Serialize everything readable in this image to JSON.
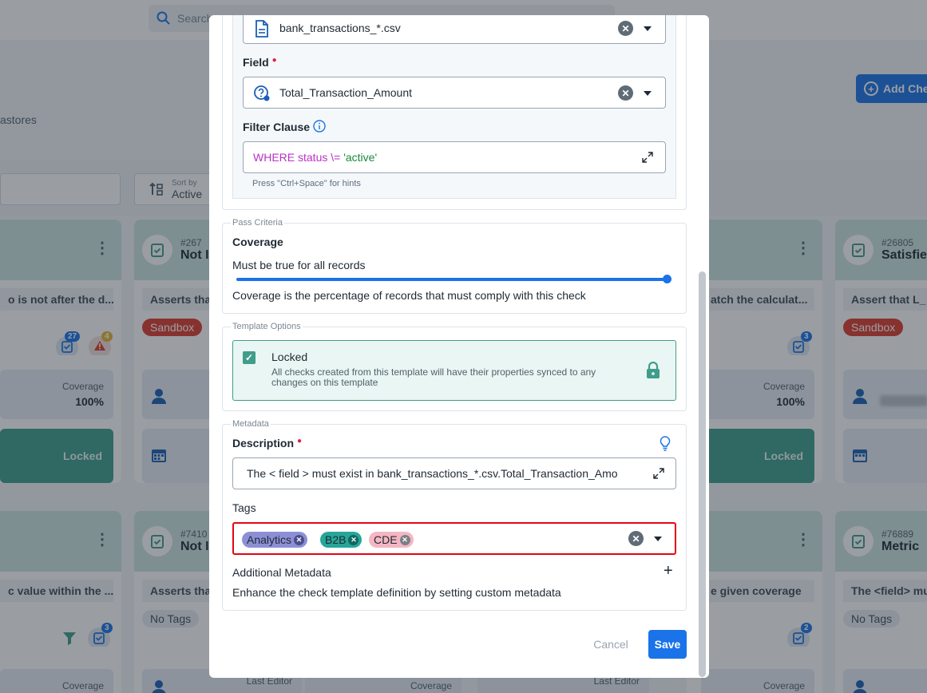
{
  "background": {
    "search_placeholder": "Search",
    "add_button_label": "Add Che",
    "tab_text": "astores",
    "sort": {
      "caption": "Sort by",
      "value": "Active"
    },
    "cards": [
      {
        "title": "",
        "description": "o is not after the d...",
        "coverage_label": "Coverage",
        "coverage_value": "100%",
        "locked_label": "Locked",
        "badge_checks": "27",
        "badge_alerts": "4"
      },
      {
        "number": "#267",
        "title": "Not I",
        "description": "Asserts tha",
        "status_tag": "Sandbox"
      },
      {
        "title": "",
        "description": "atch the calculat...",
        "coverage_label": "Coverage",
        "coverage_value": "100%",
        "locked_label": "Locked",
        "badge_checks": "3"
      },
      {
        "number": "#26805",
        "title": "Satisfie",
        "description": "Assert that L_",
        "status_tag": "Sandbox"
      },
      {
        "title": "",
        "description": "c value within the ...",
        "badge_checks": "3",
        "coverage_label": "Coverage"
      },
      {
        "number": "#7410",
        "title": "Not I",
        "description": "Asserts tha",
        "status_tag": "No Tags",
        "last_editor_label": "Last Editor"
      },
      {
        "description": "e given coverage",
        "badge_checks": "2",
        "coverage_label": "Coverage"
      },
      {
        "number": "#76889",
        "title": "Metric",
        "description": "The <field> mu",
        "status_tag": "No Tags"
      }
    ],
    "row3_labels": {
      "coverage": "Coverage",
      "last_editor": "Last Editor"
    }
  },
  "modal": {
    "file_pattern": "bank_transactions_*.csv",
    "field_label": "Field",
    "field_value": "Total_Transaction_Amount",
    "filter_label": "Filter Clause",
    "filter_keyword": "WHERE status \\= ",
    "filter_string": "'active'",
    "filter_hint": "Press \"Ctrl+Space\" for hints",
    "pass_criteria": {
      "legend": "Pass Criteria",
      "title": "Coverage",
      "rule": "Must be true for all records",
      "slider_value": 1.0,
      "note": "Coverage is the percentage of records that must comply with this check"
    },
    "template_options": {
      "legend": "Template Options",
      "locked_label": "Locked",
      "locked_checked": true,
      "locked_description": "All checks created from this template will have their properties synced to any changes on this template"
    },
    "metadata": {
      "legend": "Metadata",
      "description_label": "Description",
      "description_value": "The < field > must exist in bank_transactions_*.csv.Total_Transaction_Amo",
      "tags_label": "Tags",
      "tags": [
        {
          "label": "Analytics",
          "color": "#8d8fd6"
        },
        {
          "label": "B2B",
          "color": "#26a69a"
        },
        {
          "label": "CDE",
          "color": "#f4b6c2"
        }
      ],
      "additional_label": "Additional Metadata",
      "additional_description": "Enhance the check template definition by setting custom metadata"
    },
    "cancel_label": "Cancel",
    "save_label": "Save"
  }
}
